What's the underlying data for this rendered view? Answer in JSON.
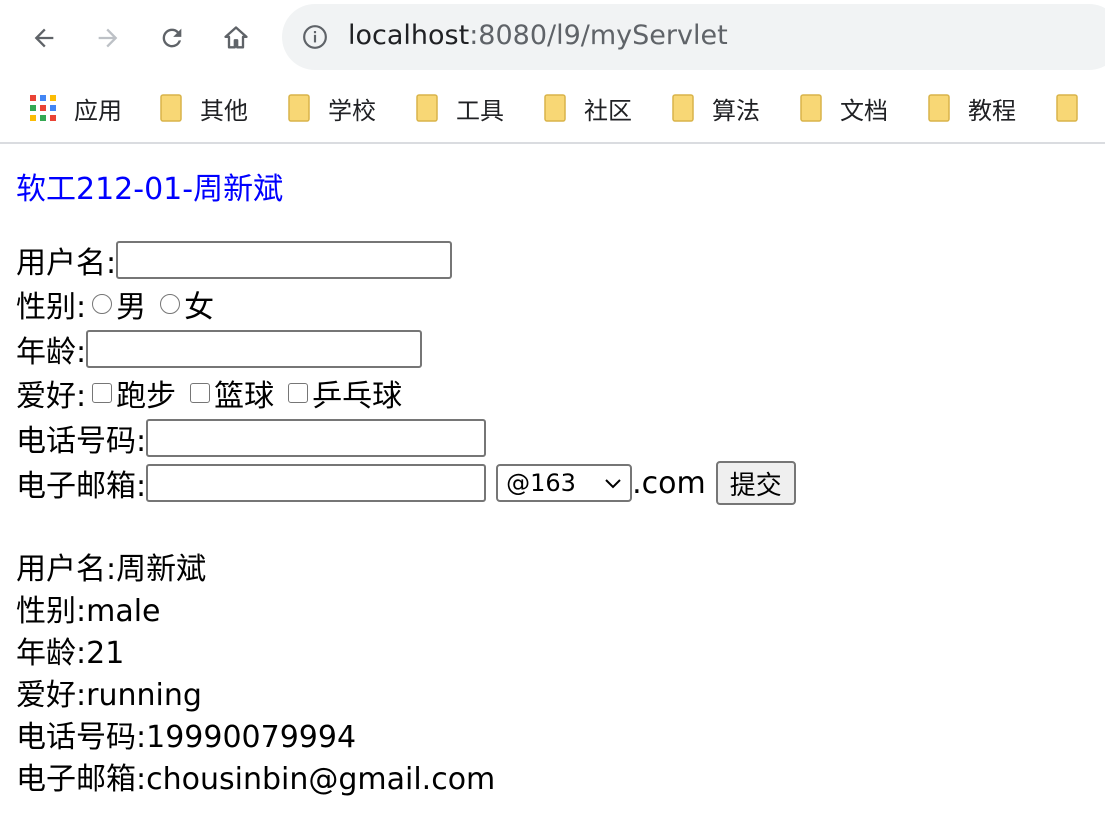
{
  "browser": {
    "url_host": "localhost",
    "url_rest": ":8080/l9/myServlet",
    "bookmarks": [
      {
        "label": "应用",
        "icon": "apps-grid-icon"
      },
      {
        "label": "其他",
        "icon": "folder-icon"
      },
      {
        "label": "学校",
        "icon": "folder-icon"
      },
      {
        "label": "工具",
        "icon": "folder-icon"
      },
      {
        "label": "社区",
        "icon": "folder-icon"
      },
      {
        "label": "算法",
        "icon": "folder-icon"
      },
      {
        "label": "文档",
        "icon": "folder-icon"
      },
      {
        "label": "教程",
        "icon": "folder-icon"
      }
    ]
  },
  "page": {
    "title": "软工212-01-周新斌",
    "form": {
      "username_label": "用户名:",
      "username_value": "",
      "gender_label": "性别:",
      "gender_options": [
        "男",
        "女"
      ],
      "age_label": "年龄:",
      "age_value": "",
      "hobby_label": "爱好:",
      "hobby_options": [
        "跑步",
        "篮球",
        "乒乓球"
      ],
      "phone_label": "电话号码:",
      "phone_value": "",
      "email_label": "电子邮箱:",
      "email_value": "",
      "email_domain_selected": "@163",
      "email_suffix": ".com",
      "submit_label": "提交"
    },
    "result": {
      "username": "用户名:周新斌",
      "gender": "性别:male",
      "age": "年龄:21",
      "hobby": "爱好:running",
      "phone": "电话号码:19990079994",
      "email": "电子邮箱:chousinbin@gmail.com"
    }
  },
  "colors": {
    "title": "#0000ff",
    "folder": "#f8d775",
    "omnibox_bg": "#f1f3f4"
  }
}
